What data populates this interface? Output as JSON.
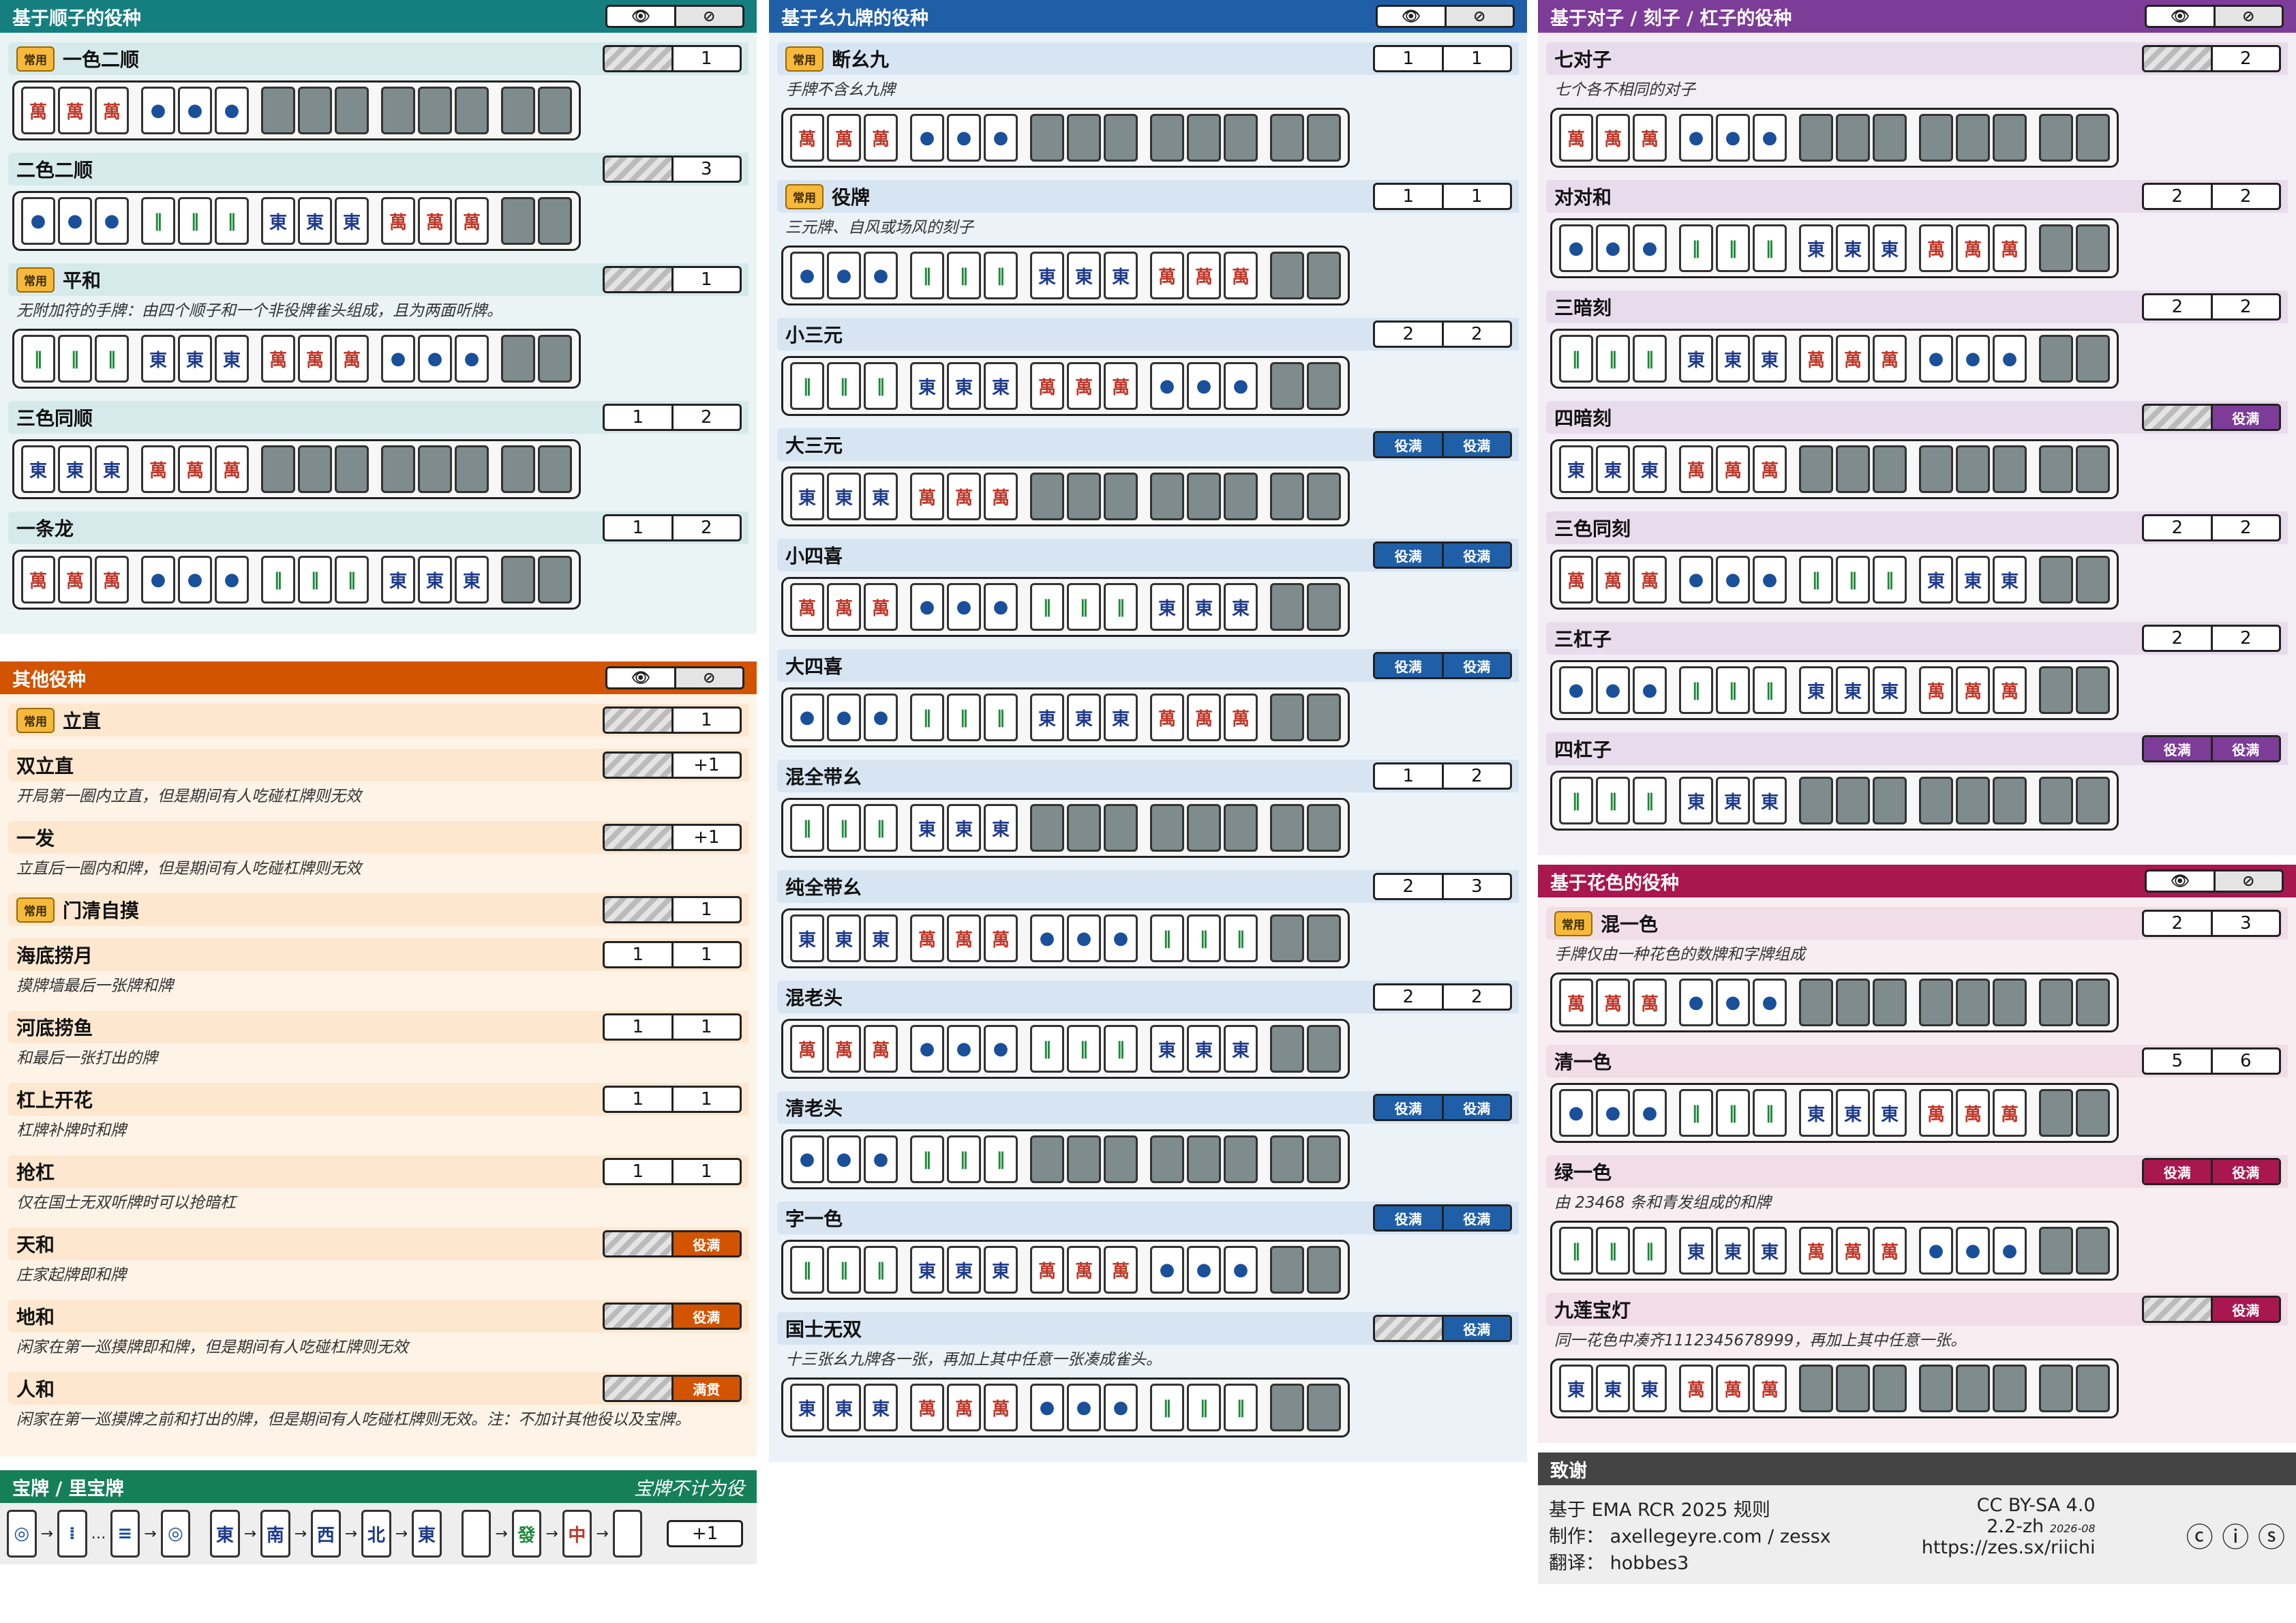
{
  "ui": {
    "eye_open": "👁",
    "eye_closed": "⊘"
  },
  "left_top": {
    "title": "基于顺子的役种",
    "color": "#157f80",
    "bg": "#d6eaeb",
    "items": [
      {
        "name": "一色二顺",
        "tag": "常用",
        "han": [
          "",
          "1"
        ]
      },
      {
        "name": "二色二顺",
        "han": [
          "",
          "3"
        ]
      },
      {
        "name": "平和",
        "tag": "常用",
        "han": [
          "",
          "1"
        ],
        "desc": "无附加符的手牌：由四个顺子和一个非役牌雀头组成，且为两面听牌。"
      },
      {
        "name": "三色同顺",
        "han": [
          "1",
          "2"
        ]
      },
      {
        "name": "一条龙",
        "han": [
          "1",
          "2"
        ]
      }
    ]
  },
  "left_mid": {
    "title": "其他役种",
    "color": "#d35400",
    "bg": "#fde7cf",
    "items": [
      {
        "name": "立直",
        "tag": "常用",
        "han": [
          "",
          "1"
        ]
      },
      {
        "name": "双立直",
        "han": [
          "",
          "+1"
        ],
        "desc": "开局第一圈内立直，但是期间有人吃碰杠牌则无效"
      },
      {
        "name": "一发",
        "han": [
          "",
          "+1"
        ],
        "desc": "立直后一圈内和牌，但是期间有人吃碰杠牌则无效"
      },
      {
        "name": "门清自摸",
        "tag": "常用",
        "han": [
          "",
          "1"
        ]
      },
      {
        "name": "海底捞月",
        "han": [
          "1",
          "1"
        ],
        "desc": "摸牌墙最后一张牌和牌"
      },
      {
        "name": "河底捞鱼",
        "han": [
          "1",
          "1"
        ],
        "desc": "和最后一张打出的牌"
      },
      {
        "name": "杠上开花",
        "han": [
          "1",
          "1"
        ],
        "desc": "杠牌补牌时和牌"
      },
      {
        "name": "抢杠",
        "han": [
          "1",
          "1"
        ],
        "desc": "仅在国士无双听牌时可以抢暗杠"
      },
      {
        "name": "天和",
        "han": [
          "",
          "役满"
        ],
        "desc": "庄家起牌即和牌"
      },
      {
        "name": "地和",
        "han": [
          "",
          "役满"
        ],
        "desc": "闲家在第一巡摸牌即和牌，但是期间有人吃碰杠牌则无效"
      },
      {
        "name": "人和",
        "han": [
          "",
          "满贯"
        ],
        "desc": "闲家在第一巡摸牌之前和打出的牌，但是期间有人吃碰杠牌则无效。注：不加计其他役以及宝牌。"
      }
    ]
  },
  "dora": {
    "title": "宝牌 / 里宝牌",
    "note": "宝牌不计为役",
    "color": "#157f5a",
    "bonus": "+1"
  },
  "mid": {
    "title": "基于幺九牌的役种",
    "color": "#1f5fa8",
    "bg": "#d7e5f2",
    "items": [
      {
        "name": "断幺九",
        "tag": "常用",
        "han": [
          "1",
          "1"
        ],
        "desc": "手牌不含幺九牌"
      },
      {
        "name": "役牌",
        "tag": "常用",
        "han": [
          "1",
          "1"
        ],
        "desc": "三元牌、自风或场风的刻子"
      },
      {
        "name": "小三元",
        "han": [
          "2",
          "2"
        ]
      },
      {
        "name": "大三元",
        "han": [
          "役满",
          "役满"
        ]
      },
      {
        "name": "小四喜",
        "han": [
          "役满",
          "役满"
        ]
      },
      {
        "name": "大四喜",
        "han": [
          "役满",
          "役满"
        ]
      },
      {
        "name": "混全带幺",
        "han": [
          "1",
          "2"
        ]
      },
      {
        "name": "纯全带幺",
        "han": [
          "2",
          "3"
        ]
      },
      {
        "name": "混老头",
        "han": [
          "2",
          "2"
        ]
      },
      {
        "name": "清老头",
        "han": [
          "役满",
          "役满"
        ]
      },
      {
        "name": "字一色",
        "han": [
          "役满",
          "役满"
        ]
      },
      {
        "name": "国士无双",
        "han": [
          "",
          "役满"
        ],
        "desc": "十三张幺九牌各一张，再加上其中任意一张凑成雀头。"
      }
    ]
  },
  "right_top": {
    "title": "基于对子 / 刻子 / 杠子的役种",
    "color": "#7d3c98",
    "bg": "#e8dcec",
    "items": [
      {
        "name": "七对子",
        "han": [
          "",
          "2"
        ],
        "desc": "七个各不相同的对子"
      },
      {
        "name": "对对和",
        "han": [
          "2",
          "2"
        ]
      },
      {
        "name": "三暗刻",
        "han": [
          "2",
          "2"
        ]
      },
      {
        "name": "四暗刻",
        "han": [
          "",
          "役满"
        ]
      },
      {
        "name": "三色同刻",
        "han": [
          "2",
          "2"
        ]
      },
      {
        "name": "三杠子",
        "han": [
          "2",
          "2"
        ]
      },
      {
        "name": "四杠子",
        "han": [
          "役满",
          "役满"
        ]
      }
    ]
  },
  "right_mid": {
    "title": "基于花色的役种",
    "color": "#a8174f",
    "bg": "#f1dde5",
    "items": [
      {
        "name": "混一色",
        "tag": "常用",
        "han": [
          "2",
          "3"
        ],
        "desc": "手牌仅由一种花色的数牌和字牌组成"
      },
      {
        "name": "清一色",
        "han": [
          "5",
          "6"
        ]
      },
      {
        "name": "绿一色",
        "han": [
          "役满",
          "役满"
        ],
        "desc": "由 23468 条和青发组成的和牌"
      },
      {
        "name": "九莲宝灯",
        "han": [
          "",
          "役满"
        ],
        "desc": "同一花色中凑齐1112345678999，再加上其中任意一张。"
      }
    ]
  },
  "credits": {
    "title": "致谢",
    "line1": "基于 EMA RCR 2025 规则",
    "line2": "制作： axellegeyre.com / zessx",
    "line3": "翻译： hobbes3",
    "lic": "CC BY-SA 4.0",
    "ver": "2.2-zh",
    "date": "2026-08",
    "url": "https://zes.sx/riichi",
    "icons": "ⓒ ⓘ ⓢ"
  }
}
